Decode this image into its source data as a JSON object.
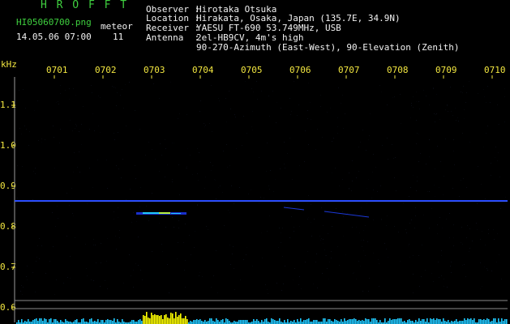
{
  "app": {
    "brand": "H R O F F T"
  },
  "file": {
    "name": "HI05060700.png",
    "datetime": "14.05.06 07:00"
  },
  "meteor": {
    "label": "meteor",
    "count": "11"
  },
  "header": {
    "lines": [
      {
        "label": "Observer :",
        "value": "Hirotaka Otsuka"
      },
      {
        "label": "Location :",
        "value": "Hirakata, Osaka, Japan (135.7E, 34.9N)"
      },
      {
        "label": "Receiver :",
        "value": "YAESU FT-690 53.749MHz, USB"
      },
      {
        "label": "Antenna  :",
        "value": "2el-HB9CV, 4m's high"
      },
      {
        "label": "",
        "value": "90-270-Azimuth (East-West), 90-Elevation (Zenith)"
      }
    ]
  },
  "axes": {
    "y_unit": "kHz",
    "x_ticks": [
      "0701",
      "0702",
      "0703",
      "0704",
      "0705",
      "0706",
      "0707",
      "0708",
      "0709",
      "0710"
    ],
    "y_ticks": [
      "1.1",
      "1.0",
      "0.9",
      "0.8",
      "0.7",
      "0.6"
    ]
  },
  "colors": {
    "background": "#000000",
    "title_green": "#3fd03f",
    "label_yellow": "#f2e640",
    "carrier_blue": "#2244ff",
    "signal_cyan": "#20c8ff",
    "signal_yellow": "#ffff00"
  }
}
